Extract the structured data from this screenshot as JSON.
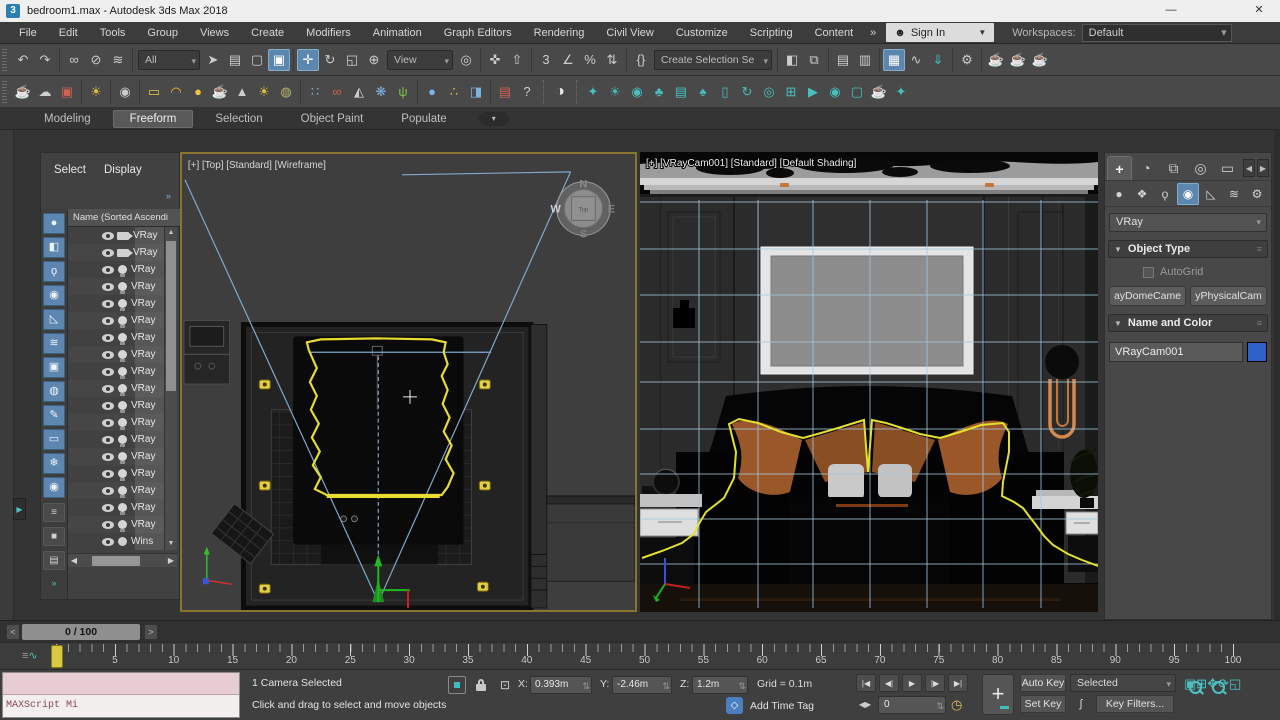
{
  "window": {
    "title": "bedroom1.max - Autodesk 3ds Max 2018",
    "app_badge": "3",
    "minimize": "—",
    "close": "✕"
  },
  "menubar": {
    "items": [
      "File",
      "Edit",
      "Tools",
      "Group",
      "Views",
      "Create",
      "Modifiers",
      "Animation",
      "Graph Editors",
      "Rendering",
      "Civil View",
      "Customize",
      "Scripting",
      "Content"
    ],
    "overflow": "»",
    "signin": {
      "icon": "☻",
      "label": "Sign In"
    },
    "workspaces_label": "Workspaces:",
    "workspaces_value": "Default"
  },
  "toolbar1": {
    "groupA": [
      {
        "n": "undo-icon",
        "g": "↶",
        "cls": "ti"
      },
      {
        "n": "redo-icon",
        "g": "↷",
        "cls": "ti"
      },
      {
        "n": "divider",
        "g": "",
        "cls": "tsep",
        "ia": "false"
      },
      {
        "n": "select-and-link-icon",
        "g": "∞",
        "cls": "ti"
      },
      {
        "n": "unlink-selection-icon",
        "g": "⊘",
        "cls": "ti"
      },
      {
        "n": "bind-to-space-warp-icon",
        "g": "≋",
        "cls": "ti"
      },
      {
        "n": "divider",
        "g": "",
        "cls": "tsep",
        "ia": "false"
      }
    ],
    "filter_dropdown": "All",
    "groupB": [
      {
        "n": "select-object-icon",
        "g": "➤",
        "cls": "ti"
      },
      {
        "n": "select-by-name-icon",
        "g": "▤",
        "cls": "ti"
      },
      {
        "n": "selection-region-icon",
        "g": "▢",
        "cls": "ti"
      },
      {
        "n": "window-crossing-icon",
        "g": "▣",
        "cls": "ti act"
      },
      {
        "n": "divider",
        "g": "",
        "cls": "tsep",
        "ia": "false"
      },
      {
        "n": "select-and-move-icon",
        "g": "✛",
        "cls": "ti act"
      },
      {
        "n": "select-and-rotate-icon",
        "g": "↻",
        "cls": "ti"
      },
      {
        "n": "select-and-scale-icon",
        "g": "◱",
        "cls": "ti"
      },
      {
        "n": "select-and-place-icon",
        "g": "⊕",
        "cls": "ti"
      }
    ],
    "coord_dropdown": "View",
    "groupC": [
      {
        "n": "use-pivot-center-icon",
        "g": "◎",
        "cls": "ti"
      },
      {
        "n": "divider",
        "g": "",
        "cls": "tsep",
        "ia": "false"
      },
      {
        "n": "select-and-manipulate-icon",
        "g": "✜",
        "cls": "ti"
      },
      {
        "n": "keyboard-override-icon",
        "g": "⇧",
        "cls": "ti"
      },
      {
        "n": "divider",
        "g": "",
        "cls": "tsep",
        "ia": "false"
      },
      {
        "n": "snaps-toggle-icon",
        "g": "3",
        "cls": "ti"
      },
      {
        "n": "angle-snap-icon",
        "g": "∠",
        "cls": "ti"
      },
      {
        "n": "percent-snap-icon",
        "g": "%",
        "cls": "ti"
      },
      {
        "n": "spinner-snap-icon",
        "g": "⇅",
        "cls": "ti"
      },
      {
        "n": "divider",
        "g": "",
        "cls": "tsep",
        "ia": "false"
      },
      {
        "n": "named-selection-sets-icon",
        "g": "{}",
        "cls": "ti"
      }
    ],
    "selset_dropdown": "Create Selection Se",
    "groupD": [
      {
        "n": "divider",
        "g": "",
        "cls": "tsep",
        "ia": "false"
      },
      {
        "n": "mirror-icon",
        "g": "◧",
        "cls": "ti"
      },
      {
        "n": "align-icon",
        "g": "⧉",
        "cls": "ti"
      },
      {
        "n": "divider",
        "g": "",
        "cls": "tsep",
        "ia": "false"
      },
      {
        "n": "scene-explorer-icon",
        "g": "▤",
        "cls": "ti"
      },
      {
        "n": "layer-explorer-icon",
        "g": "▥",
        "cls": "ti"
      },
      {
        "n": "divider",
        "g": "",
        "cls": "tsep",
        "ia": "false"
      },
      {
        "n": "ribbon-toggle-icon",
        "g": "▦",
        "cls": "ti act"
      },
      {
        "n": "curve-editor-icon",
        "g": "∿",
        "cls": "ti"
      },
      {
        "n": "dope-sheet-icon",
        "g": "⇓",
        "cls": "ti teal"
      },
      {
        "n": "divider",
        "g": "",
        "cls": "tsep",
        "ia": "false"
      },
      {
        "n": "render-setup-icon",
        "g": "⚙",
        "cls": "ti"
      },
      {
        "n": "divider",
        "g": "",
        "cls": "tsep",
        "ia": "false"
      },
      {
        "n": "rendered-frame-icon",
        "g": "☕",
        "cls": "ti gold"
      },
      {
        "n": "render-production-icon",
        "g": "☕",
        "cls": "ti teal"
      },
      {
        "n": "render-iterative-icon",
        "g": "☕",
        "cls": "ti"
      }
    ]
  },
  "toolbar2": {
    "icons": [
      {
        "n": "vray-render-icon",
        "g": "☕",
        "cls": "ti blue"
      },
      {
        "n": "chaos-cloud-icon",
        "g": "☁",
        "cls": "ti"
      },
      {
        "n": "vray-framebuffer-icon",
        "g": "▣",
        "cls": "ti red"
      },
      {
        "n": "divider",
        "g": "",
        "cls": "tsep",
        "ia": "false"
      },
      {
        "n": "light-lister-icon",
        "g": "☀",
        "cls": "ti gold"
      },
      {
        "n": "divider",
        "g": "",
        "cls": "tsep",
        "ia": "false"
      },
      {
        "n": "vray-camera-icon",
        "g": "◉",
        "cls": "ti"
      },
      {
        "n": "divider",
        "g": "",
        "cls": "tsep",
        "ia": "false"
      },
      {
        "n": "rect-light-icon",
        "g": "▭",
        "cls": "ti gold"
      },
      {
        "n": "dome-light-icon",
        "g": "◠",
        "cls": "ti gold"
      },
      {
        "n": "sphere-light-icon",
        "g": "●",
        "cls": "ti gold"
      },
      {
        "n": "mesh-light-icon",
        "g": "☕",
        "cls": "ti gold"
      },
      {
        "n": "ies-light-icon",
        "g": "▲",
        "cls": "ti"
      },
      {
        "n": "sun-light-icon",
        "g": "☀",
        "cls": "ti gold"
      },
      {
        "n": "ambient-light-icon",
        "g": "◍",
        "cls": "ti olive"
      },
      {
        "n": "divider",
        "g": "",
        "cls": "tsep",
        "ia": "false"
      },
      {
        "n": "light-array-icon",
        "g": "∷",
        "cls": "ti blue"
      },
      {
        "n": "vray-proxy-icon",
        "g": "∞",
        "cls": "ti red"
      },
      {
        "n": "dome-camera-icon",
        "g": "◭",
        "cls": "ti"
      },
      {
        "n": "vray-fur-icon",
        "g": "❋",
        "cls": "ti blue"
      },
      {
        "n": "grass-icon",
        "g": "ψ",
        "cls": "ti green"
      },
      {
        "n": "divider",
        "g": "",
        "cls": "tsep",
        "ia": "false"
      },
      {
        "n": "material-sphere-icon",
        "g": "●",
        "cls": "ti blue"
      },
      {
        "n": "multimatte-icon",
        "g": "∴",
        "cls": "ti gold"
      },
      {
        "n": "override-material-icon",
        "g": "◨",
        "cls": "ti blue"
      },
      {
        "n": "divider",
        "g": "",
        "cls": "tsep",
        "ia": "false"
      },
      {
        "n": "clipboard-icon",
        "g": "▤",
        "cls": "ti red"
      },
      {
        "n": "help-icon",
        "g": "?",
        "cls": "ti"
      },
      {
        "n": "divider",
        "g": "",
        "cls": "tsep2",
        "ia": "false"
      },
      {
        "n": "vray-logo-icon",
        "g": "◑",
        "cls": "ti big"
      },
      {
        "n": "divider",
        "g": "",
        "cls": "tsep2",
        "ia": "false"
      },
      {
        "n": "corona-light-icon",
        "g": "✦",
        "cls": "ti teal"
      },
      {
        "n": "corona-sun-icon",
        "g": "☀",
        "cls": "ti teal"
      },
      {
        "n": "corona-camera-icon",
        "g": "◉",
        "cls": "ti teal"
      },
      {
        "n": "forest-tree-icon",
        "g": "♣",
        "cls": "ti teal"
      },
      {
        "n": "forest-list-icon",
        "g": "▤",
        "cls": "ti teal"
      },
      {
        "n": "tree-icon",
        "g": "♠",
        "cls": "ti teal"
      },
      {
        "n": "tree-doc-icon",
        "g": "▯",
        "cls": "ti teal"
      },
      {
        "n": "railclone-icon",
        "g": "↻",
        "cls": "ti teal"
      },
      {
        "n": "layers-stack-icon",
        "g": "◎",
        "cls": "ti teal"
      },
      {
        "n": "viewport-split-icon",
        "g": "⊞",
        "cls": "ti teal"
      },
      {
        "n": "video-play-icon",
        "g": "▶",
        "cls": "ti teal"
      },
      {
        "n": "camera-add-icon",
        "g": "◉",
        "cls": "ti teal"
      },
      {
        "n": "window-icon",
        "g": "▢",
        "cls": "ti teal"
      },
      {
        "n": "teapot-icon",
        "g": "☕",
        "cls": "ti teal"
      },
      {
        "n": "bulb-gear-icon",
        "g": "✦",
        "cls": "ti teal"
      }
    ]
  },
  "ribbon": {
    "tabs": [
      {
        "label": "Modeling",
        "cls": "rtab"
      },
      {
        "label": "Freeform",
        "cls": "rtab act"
      },
      {
        "label": "Selection",
        "cls": "rtab"
      },
      {
        "label": "Object Paint",
        "cls": "rtab"
      },
      {
        "label": "Populate",
        "cls": "rtab"
      }
    ],
    "overflow": "▾"
  },
  "explorer": {
    "tabs": [
      "Select",
      "Display"
    ],
    "chevron": "»",
    "header": "Name (Sorted Ascendi",
    "filters": [
      {
        "n": "display-all-icon",
        "g": "●",
        "cls": "fb"
      },
      {
        "n": "display-geometry-icon",
        "g": "◧",
        "cls": "fb"
      },
      {
        "n": "display-lights-icon",
        "g": "ϙ",
        "cls": "fb"
      },
      {
        "n": "display-cameras-icon",
        "g": "◉",
        "cls": "fb"
      },
      {
        "n": "display-helpers-icon",
        "g": "◺",
        "cls": "fb"
      },
      {
        "n": "display-spacewarps-icon",
        "g": "≋",
        "cls": "fb"
      },
      {
        "n": "display-materials-icon",
        "g": "▣",
        "cls": "fb"
      },
      {
        "n": "display-dome-icon",
        "g": "◍",
        "cls": "fb"
      },
      {
        "n": "display-bones-icon",
        "g": "✎",
        "cls": "fb"
      },
      {
        "n": "display-containers-icon",
        "g": "▭",
        "cls": "fb"
      },
      {
        "n": "display-frozen-icon",
        "g": "❄",
        "cls": "fb"
      },
      {
        "n": "display-hidden-icon",
        "g": "◉",
        "cls": "fb"
      },
      {
        "n": "list-view-icon",
        "g": "≡",
        "cls": "fg"
      },
      {
        "n": "swatch-icon",
        "g": "■",
        "cls": "fg"
      },
      {
        "n": "doc-view-icon",
        "g": "▤",
        "cls": "fg"
      }
    ],
    "rows": [
      {
        "cls": "i-cam",
        "label": "VRay"
      },
      {
        "cls": "i-cam",
        "label": "VRay"
      },
      {
        "cls": "i-bulb",
        "label": "VRay"
      },
      {
        "cls": "i-bulb",
        "label": "VRay"
      },
      {
        "cls": "i-bulb",
        "label": "VRay"
      },
      {
        "cls": "i-bulb",
        "label": "VRay"
      },
      {
        "cls": "i-bulb",
        "label": "VRay"
      },
      {
        "cls": "i-bulb",
        "label": "VRay"
      },
      {
        "cls": "i-bulb",
        "label": "VRay"
      },
      {
        "cls": "i-bulb",
        "label": "VRay"
      },
      {
        "cls": "i-bulb",
        "label": "VRay"
      },
      {
        "cls": "i-bulb",
        "label": "VRay"
      },
      {
        "cls": "i-bulb",
        "label": "VRay"
      },
      {
        "cls": "i-bulb",
        "label": "VRay"
      },
      {
        "cls": "i-bulb",
        "label": "VRay"
      },
      {
        "cls": "i-bulb",
        "label": "VRay"
      },
      {
        "cls": "i-bulb",
        "label": "VRay"
      },
      {
        "cls": "i-bulb",
        "label": "VRay"
      },
      {
        "cls": "i-sphere",
        "label": "Wins"
      }
    ]
  },
  "viewport_left": {
    "label": "[+] [Top] [Standard] [Wireframe]",
    "compass": {
      "n": "N",
      "e": "E",
      "s": "S",
      "w": "W",
      "cube": "Top"
    }
  },
  "viewport_right": {
    "label": "[+] [VRayCam001] [Standard] [Default Shading]"
  },
  "command_panel": {
    "tabs": [
      {
        "n": "create-tab-icon",
        "g": "+",
        "cls": "ct act"
      },
      {
        "n": "modify-tab-icon",
        "g": "◔",
        "cls": "ct"
      },
      {
        "n": "hierarchy-tab-icon",
        "g": "⧉",
        "cls": "ct"
      },
      {
        "n": "motion-tab-icon",
        "g": "◎",
        "cls": "ct"
      },
      {
        "n": "display-tab-icon",
        "g": "▭",
        "cls": "ct"
      }
    ],
    "tab_prev": "◀",
    "tab_next": "▶",
    "categories": [
      {
        "n": "geometry-category-icon",
        "g": "●",
        "cls": "cc"
      },
      {
        "n": "shapes-category-icon",
        "g": "❖",
        "cls": "cc"
      },
      {
        "n": "lights-category-icon",
        "g": "ϙ",
        "cls": "cc"
      },
      {
        "n": "cameras-category-icon",
        "g": "◉",
        "cls": "cc act"
      },
      {
        "n": "helpers-category-icon",
        "g": "◺",
        "cls": "cc"
      },
      {
        "n": "spacewarps-category-icon",
        "g": "≋",
        "cls": "cc"
      },
      {
        "n": "systems-category-icon",
        "g": "⚙",
        "cls": "cc"
      }
    ],
    "dropdown": "VRay",
    "object_type": {
      "title": "Object Type",
      "collapse": "▼",
      "grip": "≡",
      "autogrid": "AutoGrid",
      "btn1": "ayDomeCame",
      "btn2": "yPhysicalCam"
    },
    "name_color": {
      "title": "Name and Color",
      "collapse": "▼",
      "grip": "≡",
      "value": "VRayCam001",
      "color": "#2e62c8"
    }
  },
  "timeline": {
    "prev": "<",
    "next": ">",
    "slider": "0 / 100",
    "ticks": [
      "0",
      "5",
      "10",
      "15",
      "20",
      "25",
      "30",
      "35",
      "40",
      "45",
      "50",
      "55",
      "60",
      "65",
      "70",
      "75",
      "80",
      "85",
      "90",
      "95",
      "100"
    ]
  },
  "status": {
    "maxscript": "MAXScript Mi",
    "line1": "1 Camera Selected",
    "line2": "Click and drag to select and move objects",
    "x_label": "X:",
    "x_value": "0.393m",
    "y_label": "Y:",
    "y_value": "-2.46m",
    "z_label": "Z:",
    "z_value": "1.2m",
    "grid_info": "Grid = 0.1m",
    "add_time_tag": "Add Time Tag",
    "tag_glyph": "◇",
    "playback": [
      {
        "n": "go-to-start-icon",
        "g": "|◀"
      },
      {
        "n": "previous-frame-icon",
        "g": "◀|"
      },
      {
        "n": "play-icon",
        "g": "▶"
      },
      {
        "n": "next-frame-icon",
        "g": "|▶"
      },
      {
        "n": "go-to-end-icon",
        "g": "▶|"
      }
    ],
    "stepper": "◀▶",
    "frame_value": "0",
    "clock_glyph": "◷",
    "set_keys_glyph": "+",
    "auto_key": "Auto Key",
    "set_key": "Set Key",
    "selection_set": "Selected",
    "key_glyph": "ʃ",
    "key_filters": "Key Filters...",
    "nav_icons": [
      {
        "n": "zoom-icon",
        "g": "",
        "cls": "nav mag"
      },
      {
        "n": "zoom-all-icon",
        "g": "",
        "cls": "nav mag dot"
      },
      {
        "n": "zoom-extents-icon",
        "g": "▣",
        "cls": "nav"
      },
      {
        "n": "zoom-extents-all-icon",
        "g": "⊞",
        "cls": "nav"
      },
      {
        "n": "zoom-region-icon",
        "g": "",
        "cls": "nav mag"
      },
      {
        "n": "pan-icon",
        "g": "✥",
        "cls": "nav"
      },
      {
        "n": "orbit-icon",
        "g": "⟳",
        "cls": "nav"
      },
      {
        "n": "maximize-viewport-icon",
        "g": "◱",
        "cls": "nav"
      }
    ]
  },
  "colors": {
    "accent_blue": "#5b86ad",
    "teal": "#3fbdbd",
    "selection_yellow": "#e8dc30",
    "fov_blue": "#7fa9cf",
    "swatch_blue": "#2e62c8",
    "marker_yellow": "#d9c940"
  }
}
